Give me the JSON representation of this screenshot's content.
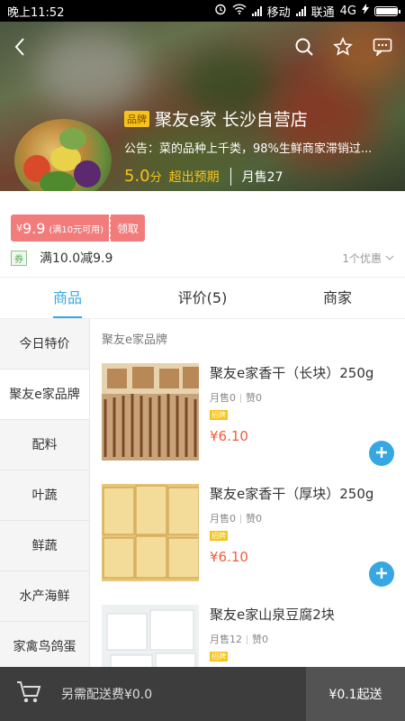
{
  "status_bar": {
    "time": "晚上11:52",
    "carrier1": "移动",
    "carrier2": "联通",
    "network": "4G"
  },
  "header": {
    "brand_tag": "品牌",
    "shop_name": "聚友e家  长沙自营店",
    "notice": "公告：菜的品种上千类，98%生鲜商家滞销过...",
    "score": "5.0",
    "score_unit": "分",
    "score_note": "超出预期",
    "monthly_sales": "月售27",
    "icons": [
      "back-icon",
      "search-icon",
      "star-icon",
      "message-icon"
    ]
  },
  "coupon": {
    "currency": "¥",
    "amount": "9.9",
    "condition": "(满10元可用)",
    "claim_label": "领取"
  },
  "promotion": {
    "badge": "券",
    "text": "满10.0减9.9",
    "count": "1个优惠"
  },
  "tabs": [
    {
      "label": "商品",
      "active": true
    },
    {
      "label": "评价(5)",
      "active": false
    },
    {
      "label": "商家",
      "active": false
    }
  ],
  "categories": [
    "今日特价",
    "聚友e家品牌",
    "配料",
    "叶蔬",
    "鲜蔬",
    "水产海鲜",
    "家禽鸟鸽蛋"
  ],
  "active_category": "聚友e家品牌",
  "section_title": "聚友e家品牌",
  "products": [
    {
      "title": "聚友e家香干（长块）250g",
      "sales": "月售0",
      "likes": "赞0",
      "tag": "招牌",
      "price": "¥6.10"
    },
    {
      "title": "聚友e家香干（厚块）250g",
      "sales": "月售0",
      "likes": "赞0",
      "tag": "招牌",
      "price": "¥6.10"
    },
    {
      "title": "聚友e家山泉豆腐2块",
      "sales": "月售12",
      "likes": "赞0",
      "tag": "招牌",
      "price": ""
    }
  ],
  "bottom_bar": {
    "delivery_text": "另需配送费¥0.0",
    "checkout_text": "¥0.1起送"
  },
  "colors": {
    "accent": "#36a7e3",
    "price": "#f25c3a",
    "coupon": "#f27b7b",
    "gold": "#f6c31a"
  }
}
